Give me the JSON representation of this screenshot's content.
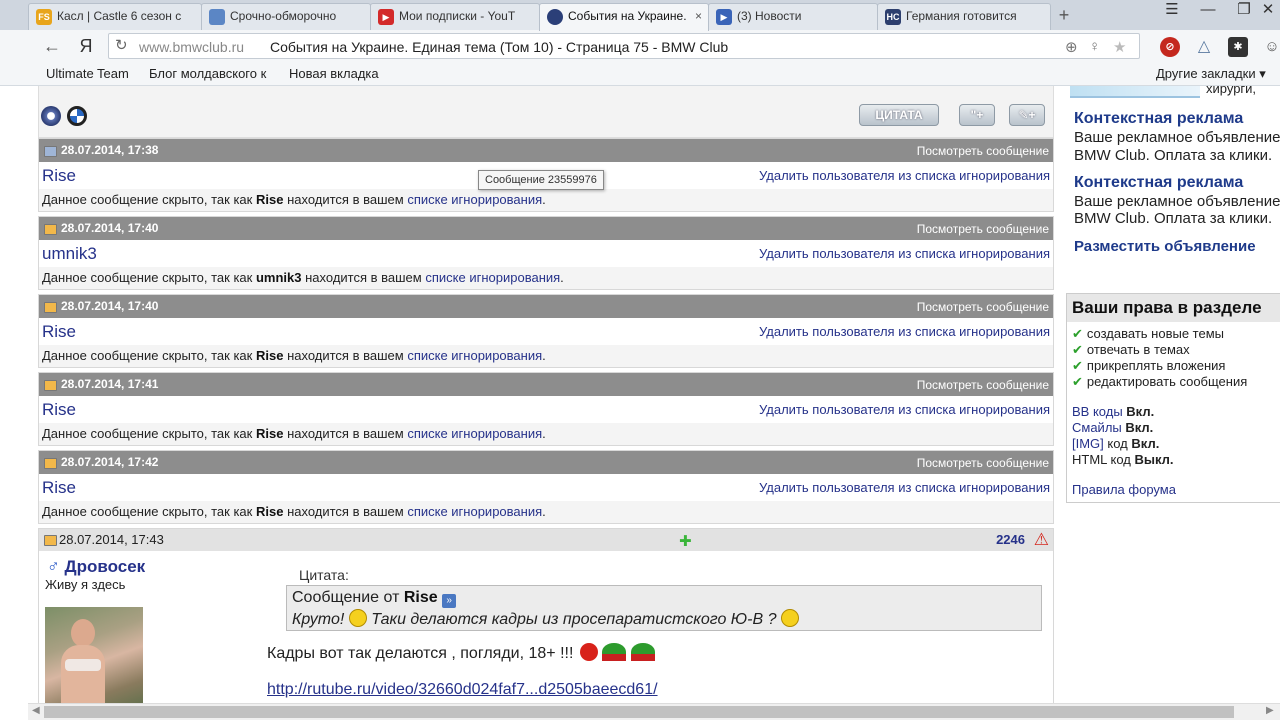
{
  "tabs": [
    {
      "label": "Касл | Castle 6 сезон с",
      "favicon": "FS",
      "color": "#e8a51c"
    },
    {
      "label": "Срочно-обморочно",
      "favicon": "",
      "color": "#5b86c5"
    },
    {
      "label": "Мои подписки - YouT",
      "favicon": "",
      "color": "#d32a2a"
    },
    {
      "label": "События на Украине.",
      "favicon": "",
      "color": "#2b3f78",
      "active": true
    },
    {
      "label": "(3) Новости",
      "favicon": "",
      "color": "#3a64b8"
    },
    {
      "label": "Германия готовится",
      "favicon": "НС",
      "color": "#2d3f6e"
    }
  ],
  "tab_close": "×",
  "newtab": "+",
  "window": {
    "menu": "☰",
    "minimize": "—",
    "restore": "❐",
    "close": "✕"
  },
  "nav": {
    "back": "←",
    "yandex": "Я",
    "reload": "↻"
  },
  "omnibox": {
    "host": "www.bmwclub.ru",
    "title": "События на Украине. Единая тема (Том 10) - Страница 75 - BMW Club"
  },
  "bookmarks": [
    {
      "label": "Ultimate Team"
    },
    {
      "label": "Блог молдавского к"
    },
    {
      "label": "Новая вкладка"
    }
  ],
  "other_bookmarks": "Другие закладки ▾",
  "toolbar": {
    "quote_label": "ЦИТАТА",
    "multiquote_label": "\"+",
    "reply_label": "✎+"
  },
  "tooltip": "Сообщение 23559976",
  "posts": [
    {
      "date": "28.07.2014, 17:38",
      "user": "Rise",
      "view": "Посмотреть сообщение",
      "delete": "Удалить пользователя из списка игнорирования",
      "msg_prefix": "Данное сообщение скрыто, так как",
      "msg_user": "Rise",
      "msg_mid": "находится в вашем",
      "msg_link": "списке игнорирования",
      "msg_end": ".",
      "icon_color": "#9fb5d6"
    },
    {
      "date": "28.07.2014, 17:40",
      "user": "umnik3",
      "view": "Посмотреть сообщение",
      "delete": "Удалить пользователя из списка игнорирования",
      "msg_prefix": "Данное сообщение скрыто, так как",
      "msg_user": "umnik3",
      "msg_mid": "находится в вашем",
      "msg_link": "списке игнорирования",
      "msg_end": ".",
      "icon_color": "#f2b84a"
    },
    {
      "date": "28.07.2014, 17:40",
      "user": "Rise",
      "view": "Посмотреть сообщение",
      "delete": "Удалить пользователя из списка игнорирования",
      "msg_prefix": "Данное сообщение скрыто, так как",
      "msg_user": "Rise",
      "msg_mid": "находится в вашем",
      "msg_link": "списке игнорирования",
      "msg_end": ".",
      "icon_color": "#f2b84a"
    },
    {
      "date": "28.07.2014, 17:41",
      "user": "Rise",
      "view": "Посмотреть сообщение",
      "delete": "Удалить пользователя из списка игнорирования",
      "msg_prefix": "Данное сообщение скрыто, так как",
      "msg_user": "Rise",
      "msg_mid": "находится в вашем",
      "msg_link": "списке игнорирования",
      "msg_end": ".",
      "icon_color": "#f2b84a"
    },
    {
      "date": "28.07.2014, 17:42",
      "user": "Rise",
      "view": "Посмотреть сообщение",
      "delete": "Удалить пользователя из списка игнорирования",
      "msg_prefix": "Данное сообщение скрыто, так как",
      "msg_user": "Rise",
      "msg_mid": "находится в вашем",
      "msg_link": "списке игнорирования",
      "msg_end": ".",
      "icon_color": "#f2b84a"
    }
  ],
  "open_post": {
    "date": "28.07.2014, 17:43",
    "number": "2246",
    "author": "Дровосек",
    "sex_symbol": "♂",
    "status": "Живу я здесь",
    "quote_label": "Цитата:",
    "quote_from_prefix": "Сообщение от",
    "quote_from_user": "Rise",
    "quote_text_1": "Круто!",
    "quote_text_2": "Таки делаются кадры из просепаратистского Ю-В ?",
    "reply_text": "Кадры вот так делаются , погляди, 18+ !!!",
    "link": "http://rutube.ru/video/32660d024faf7...d2505baeecd61/"
  },
  "sidebar": {
    "ad_top_text": "хирурги, отзывы",
    "ads": [
      {
        "title": "Контекстная реклама",
        "line1": "Ваше рекламное объявление",
        "line2": "BMW Club. Оплата за клики."
      },
      {
        "title": "Контекстная реклама",
        "line1": "Ваше рекламное объявление",
        "line2": "BMW Club. Оплата за клики."
      }
    ],
    "place_ad": "Разместить объявление",
    "rights_title": "Ваши права в разделе",
    "rights": [
      "создавать новые темы",
      "отвечать в темах",
      "прикреплять вложения",
      "редактировать сообщения"
    ],
    "codes": [
      {
        "name": "BB коды",
        "name_rest": "",
        "value": "Вкл.",
        "link": true
      },
      {
        "name": "Смайлы",
        "name_rest": "",
        "value": "Вкл.",
        "link": true
      },
      {
        "name": "[IMG]",
        "name_rest": " код",
        "value": "Вкл.",
        "link": true
      },
      {
        "name": "HTML",
        "name_rest": " код",
        "value": "Выкл.",
        "link": false
      }
    ],
    "rules": "Правила форума"
  }
}
